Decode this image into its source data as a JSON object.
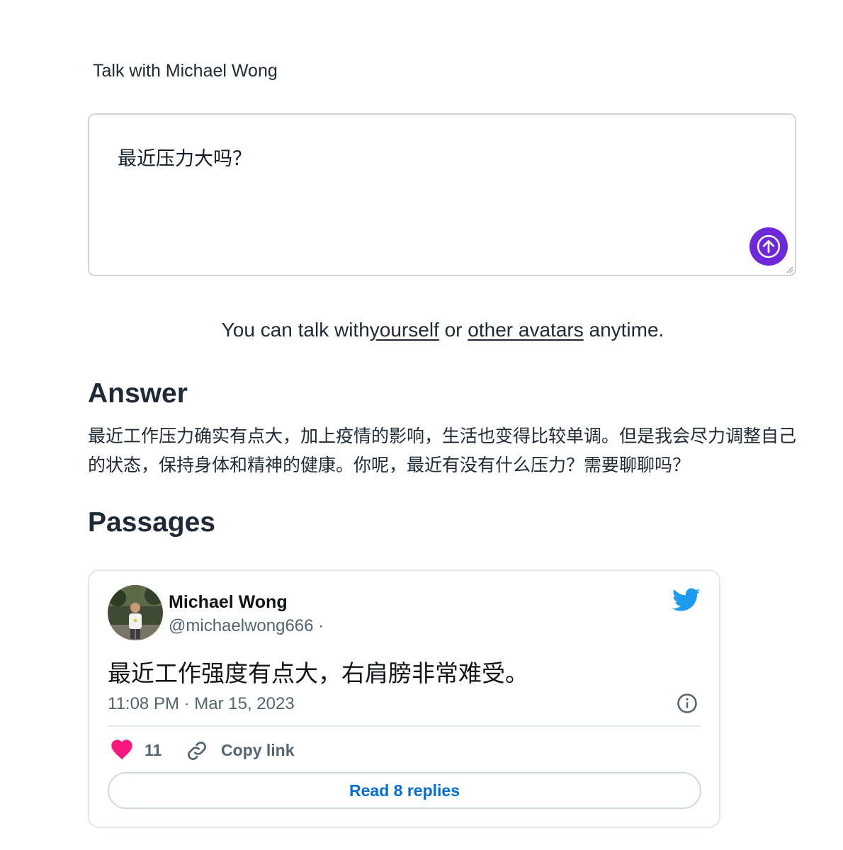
{
  "header": {
    "title": "Talk with Michael Wong"
  },
  "prompt": {
    "text": "最近压力大吗？",
    "send_icon": "arrow-up-icon",
    "accent_color": "#6d28d9"
  },
  "hint": {
    "prefix": "You can talk with",
    "yourself_link": "yourself",
    "middle": " or ",
    "avatars_link": "other avatars",
    "suffix": " anytime."
  },
  "answer": {
    "heading": "Answer",
    "text": "最近工作压力确实有点大，加上疫情的影响，生活也变得比较单调。但是我会尽力调整自己的状态，保持身体和精神的健康。你呢，最近有没有什么压力？需要聊聊吗？"
  },
  "passages": {
    "heading": "Passages",
    "tweet": {
      "author_name": "Michael Wong",
      "author_handle": "@michaelwong666 ·",
      "text": "最近工作强度有点大，右肩膀非常难受。",
      "timestamp": "11:08 PM · Mar 15, 2023",
      "like_count": "11",
      "copy_link_label": "Copy link",
      "read_replies_label": "Read 8 replies",
      "icons": [
        "twitter-logo-icon",
        "info-icon",
        "heart-icon",
        "link-icon"
      ],
      "colors": {
        "twitter_blue": "#1d9bf0",
        "heart": "#f91880",
        "link": "#006fd6"
      }
    }
  }
}
